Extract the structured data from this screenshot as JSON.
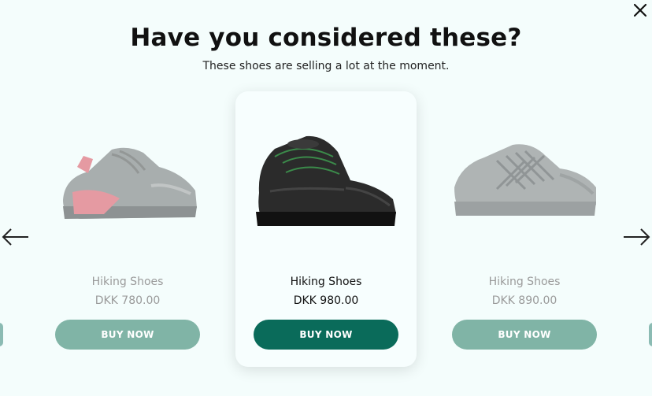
{
  "title": "Have you considered these?",
  "subtitle": "These shoes are selling a lot at the moment.",
  "colors": {
    "accent": "#0a6b5a",
    "accent_faded": "#80b4a6",
    "background": "#f4fdfc"
  },
  "products": [
    {
      "name": "Hiking Shoes",
      "price": "DKK 780.00",
      "button": "BUY NOW",
      "state": "faded",
      "icon": "gray-red-sneaker"
    },
    {
      "name": "Hiking Shoes",
      "price": "DKK 980.00",
      "button": "BUY NOW",
      "state": "active",
      "icon": "black-work-boot"
    },
    {
      "name": "Hiking Shoes",
      "price": "DKK 890.00",
      "button": "BUY NOW",
      "state": "faded",
      "icon": "gray-hiking-shoe"
    }
  ],
  "icons": {
    "close": "close-icon",
    "prev": "arrow-left-icon",
    "next": "arrow-right-icon"
  }
}
